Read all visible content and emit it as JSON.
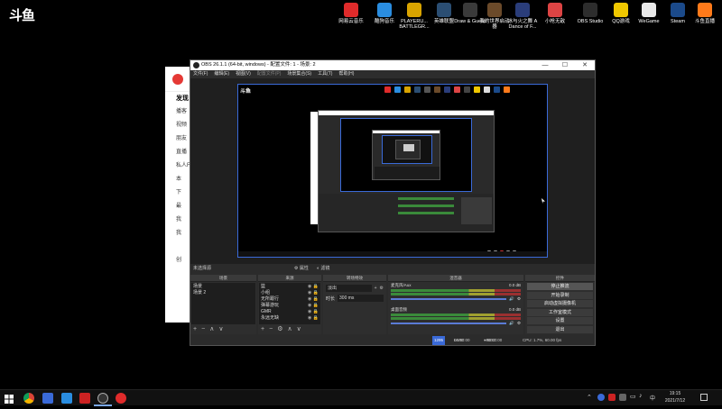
{
  "desktop": {
    "logo": "斗鱼",
    "icons": [
      {
        "label": "网易云音乐",
        "icon": "netease-music-icon",
        "color": "#e02b2b"
      },
      {
        "label": "酷狗音乐",
        "icon": "kugou-music-icon",
        "color": "#2a8de0"
      },
      {
        "label": "PLAYERU... BATTLEGR...",
        "icon": "pubg-icon",
        "color": "#d9a400"
      },
      {
        "label": "英雄联盟",
        "icon": "league-icon",
        "color": "#2b4e73"
      },
      {
        "label": "Draw & Guess",
        "icon": "draw-guess-icon",
        "color": "#3a3a3a"
      },
      {
        "label": "我的世界启动器",
        "icon": "minecraft-launcher-icon",
        "color": "#6b4a2a"
      },
      {
        "label": "冰与火之舞 A Dance of F...",
        "icon": "dance-of-fire-icon",
        "color": "#2a3d7a"
      },
      {
        "label": "小枪无敌",
        "icon": "xiaoqiang-icon",
        "color": "#d44"
      },
      {
        "label": "OBS Studio",
        "icon": "obs-studio-icon",
        "color": "#2d2d2d"
      },
      {
        "label": "QQ游戏",
        "icon": "qq-games-icon",
        "color": "#f0c800"
      },
      {
        "label": "WeGame",
        "icon": "wegame-icon",
        "color": "#e9e9e9"
      },
      {
        "label": "Steam",
        "icon": "steam-icon",
        "color": "#1b4a8a"
      },
      {
        "label": "斗鱼直播",
        "icon": "douyu-icon",
        "color": "#ff7a1a"
      }
    ]
  },
  "music_app": {
    "items": [
      "发现",
      "播客",
      "视频",
      "朋友",
      "直播",
      "私人F",
      "本",
      "下",
      "最",
      "我",
      "我",
      "",
      "创"
    ]
  },
  "obs": {
    "title": "OBS 26.1.1 (64-bit, windows) - 配置文件: 1 - 场景: 2",
    "window_buttons": [
      "—",
      "☐",
      "✕"
    ],
    "menu": [
      "文件(F)",
      "编辑(E)",
      "视图(V)",
      "配置文件(P)",
      "场景集合(S)",
      "工具(T)",
      "帮助(H)"
    ],
    "toolbar_strip": {
      "label": "未选择源",
      "props": "属性",
      "filters": "滤镜"
    },
    "scenes": {
      "title": "场景",
      "items": [
        "场景",
        "场景 2"
      ]
    },
    "sources": {
      "title": "来源",
      "items": [
        "篮",
        "小组",
        "无所跟行",
        "弹幕游玩",
        "GMR",
        "永远无缺"
      ]
    },
    "transitions": {
      "title": "转场特效",
      "type": "淡出",
      "duration_label": "时长",
      "duration": "300 ms"
    },
    "mixer": {
      "title": "混音器",
      "tracks": [
        {
          "name": "麦克风/Aux",
          "db": "0.0 dB"
        },
        {
          "name": "桌面音频",
          "db": "0.0 dB"
        }
      ]
    },
    "controls": {
      "title": "控件",
      "buttons": [
        "停止推流",
        "开始录制",
        "启动虚拟摄像机",
        "工作室模式",
        "设置",
        "退出"
      ]
    },
    "status": {
      "live_label": "LIVE:",
      "live_time": "00:00:00",
      "rec_label": "REC:",
      "rec_time": "00:00:00",
      "cpu": "CPU: 1.7%, 60.00 fps",
      "kbps": "1295"
    }
  },
  "taskbar": {
    "apps": [
      "windows-start-icon",
      "chrome-icon",
      "obs-taskbar-icon",
      "vscode-icon",
      "red-app-icon",
      "obs-active-icon",
      "netease-taskbar-icon"
    ],
    "time": "19:15",
    "date": "2021/7/12",
    "lang": "中"
  }
}
